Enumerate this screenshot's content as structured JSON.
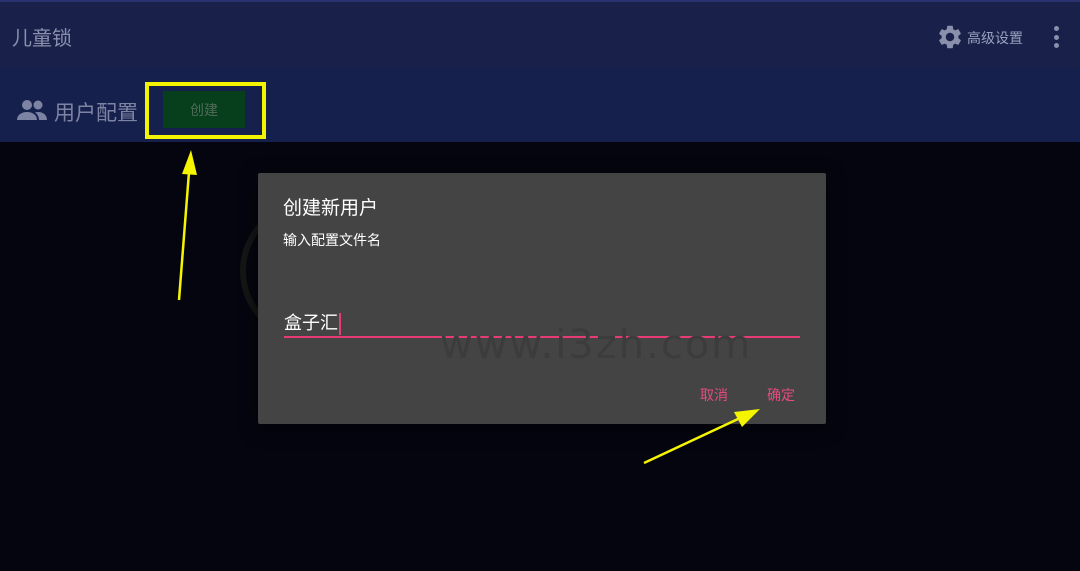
{
  "app_bar": {
    "title": "儿童锁",
    "settings_label": "高级设置"
  },
  "sub_bar": {
    "section_label": "用户配置",
    "create_label": "创建"
  },
  "dialog": {
    "title": "创建新用户",
    "message": "输入配置文件名",
    "input_value": "盒子汇",
    "cancel_label": "取消",
    "ok_label": "确定"
  },
  "watermark": "www.i3zh.com",
  "colors": {
    "app_bar": "#19204a",
    "sub_bar": "#16204d",
    "background": "#05050f",
    "dialog": "#444444",
    "accent": "#e63b77",
    "highlight": "#f3f500",
    "create_button": "#073f1d"
  },
  "icons": {
    "settings": "gear-icon",
    "menu": "more-vert-icon",
    "section": "people-icon"
  }
}
